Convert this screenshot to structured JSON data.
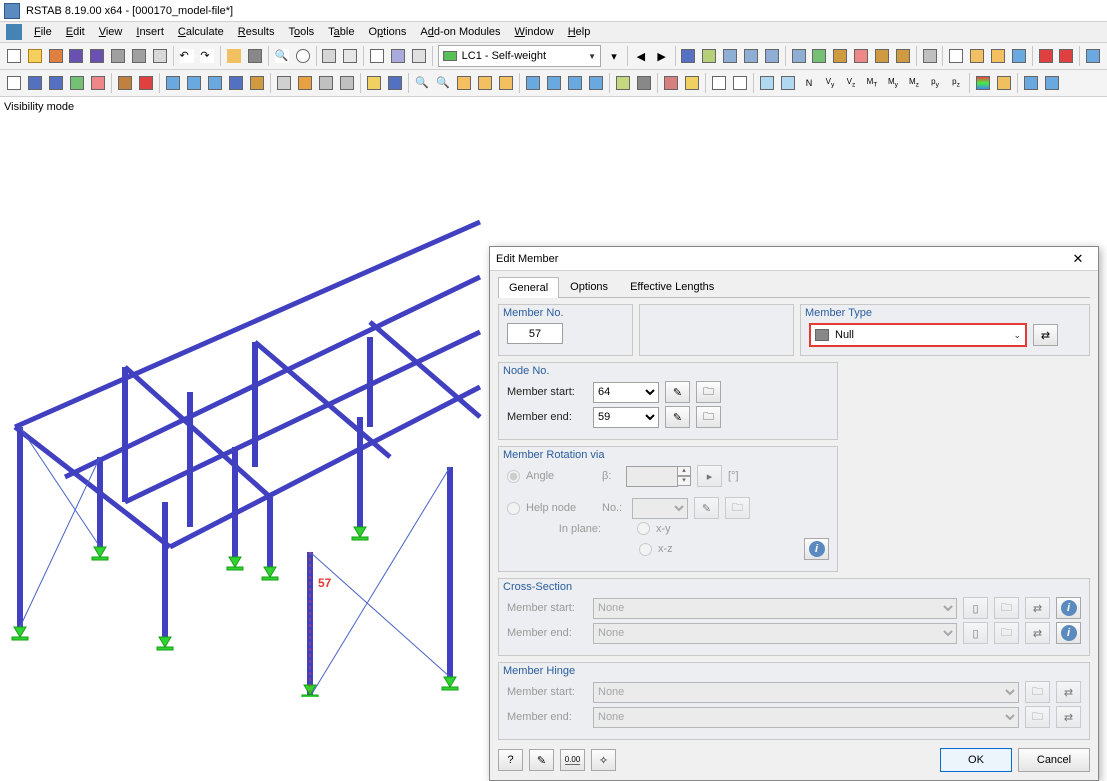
{
  "title": "RSTAB 8.19.00 x64 - [000170_model-file*]",
  "menu": [
    "File",
    "Edit",
    "View",
    "Insert",
    "Calculate",
    "Results",
    "Tools",
    "Table",
    "Options",
    "Add-on Modules",
    "Window",
    "Help"
  ],
  "load_case": "LC1 - Self-weight",
  "viewport_label": "Visibility mode",
  "selected_member_label": "57",
  "dialog": {
    "title": "Edit Member",
    "tabs": [
      "General",
      "Options",
      "Effective Lengths"
    ],
    "member_no_label": "Member No.",
    "member_no_value": "57",
    "member_type_label": "Member Type",
    "member_type_value": "Null",
    "node_no_label": "Node No.",
    "member_start_label": "Member start:",
    "member_end_label": "Member end:",
    "node_start": "64",
    "node_end": "59",
    "rotation_label": "Member Rotation via",
    "rot_angle": "Angle",
    "rot_beta": "β:",
    "rot_unit": "[°]",
    "rot_help": "Help node",
    "rot_no": "No.:",
    "rot_plane": "In plane:",
    "rot_xy": "x-y",
    "rot_xz": "x-z",
    "cross_section_label": "Cross-Section",
    "cs_start": "Member start:",
    "cs_start_val": "None",
    "cs_end": "Member end:",
    "cs_end_val": "None",
    "hinge_label": "Member Hinge",
    "h_start": "Member start:",
    "h_start_val": "None",
    "h_end": "Member end:",
    "h_end_val": "None",
    "ok": "OK",
    "cancel": "Cancel"
  }
}
